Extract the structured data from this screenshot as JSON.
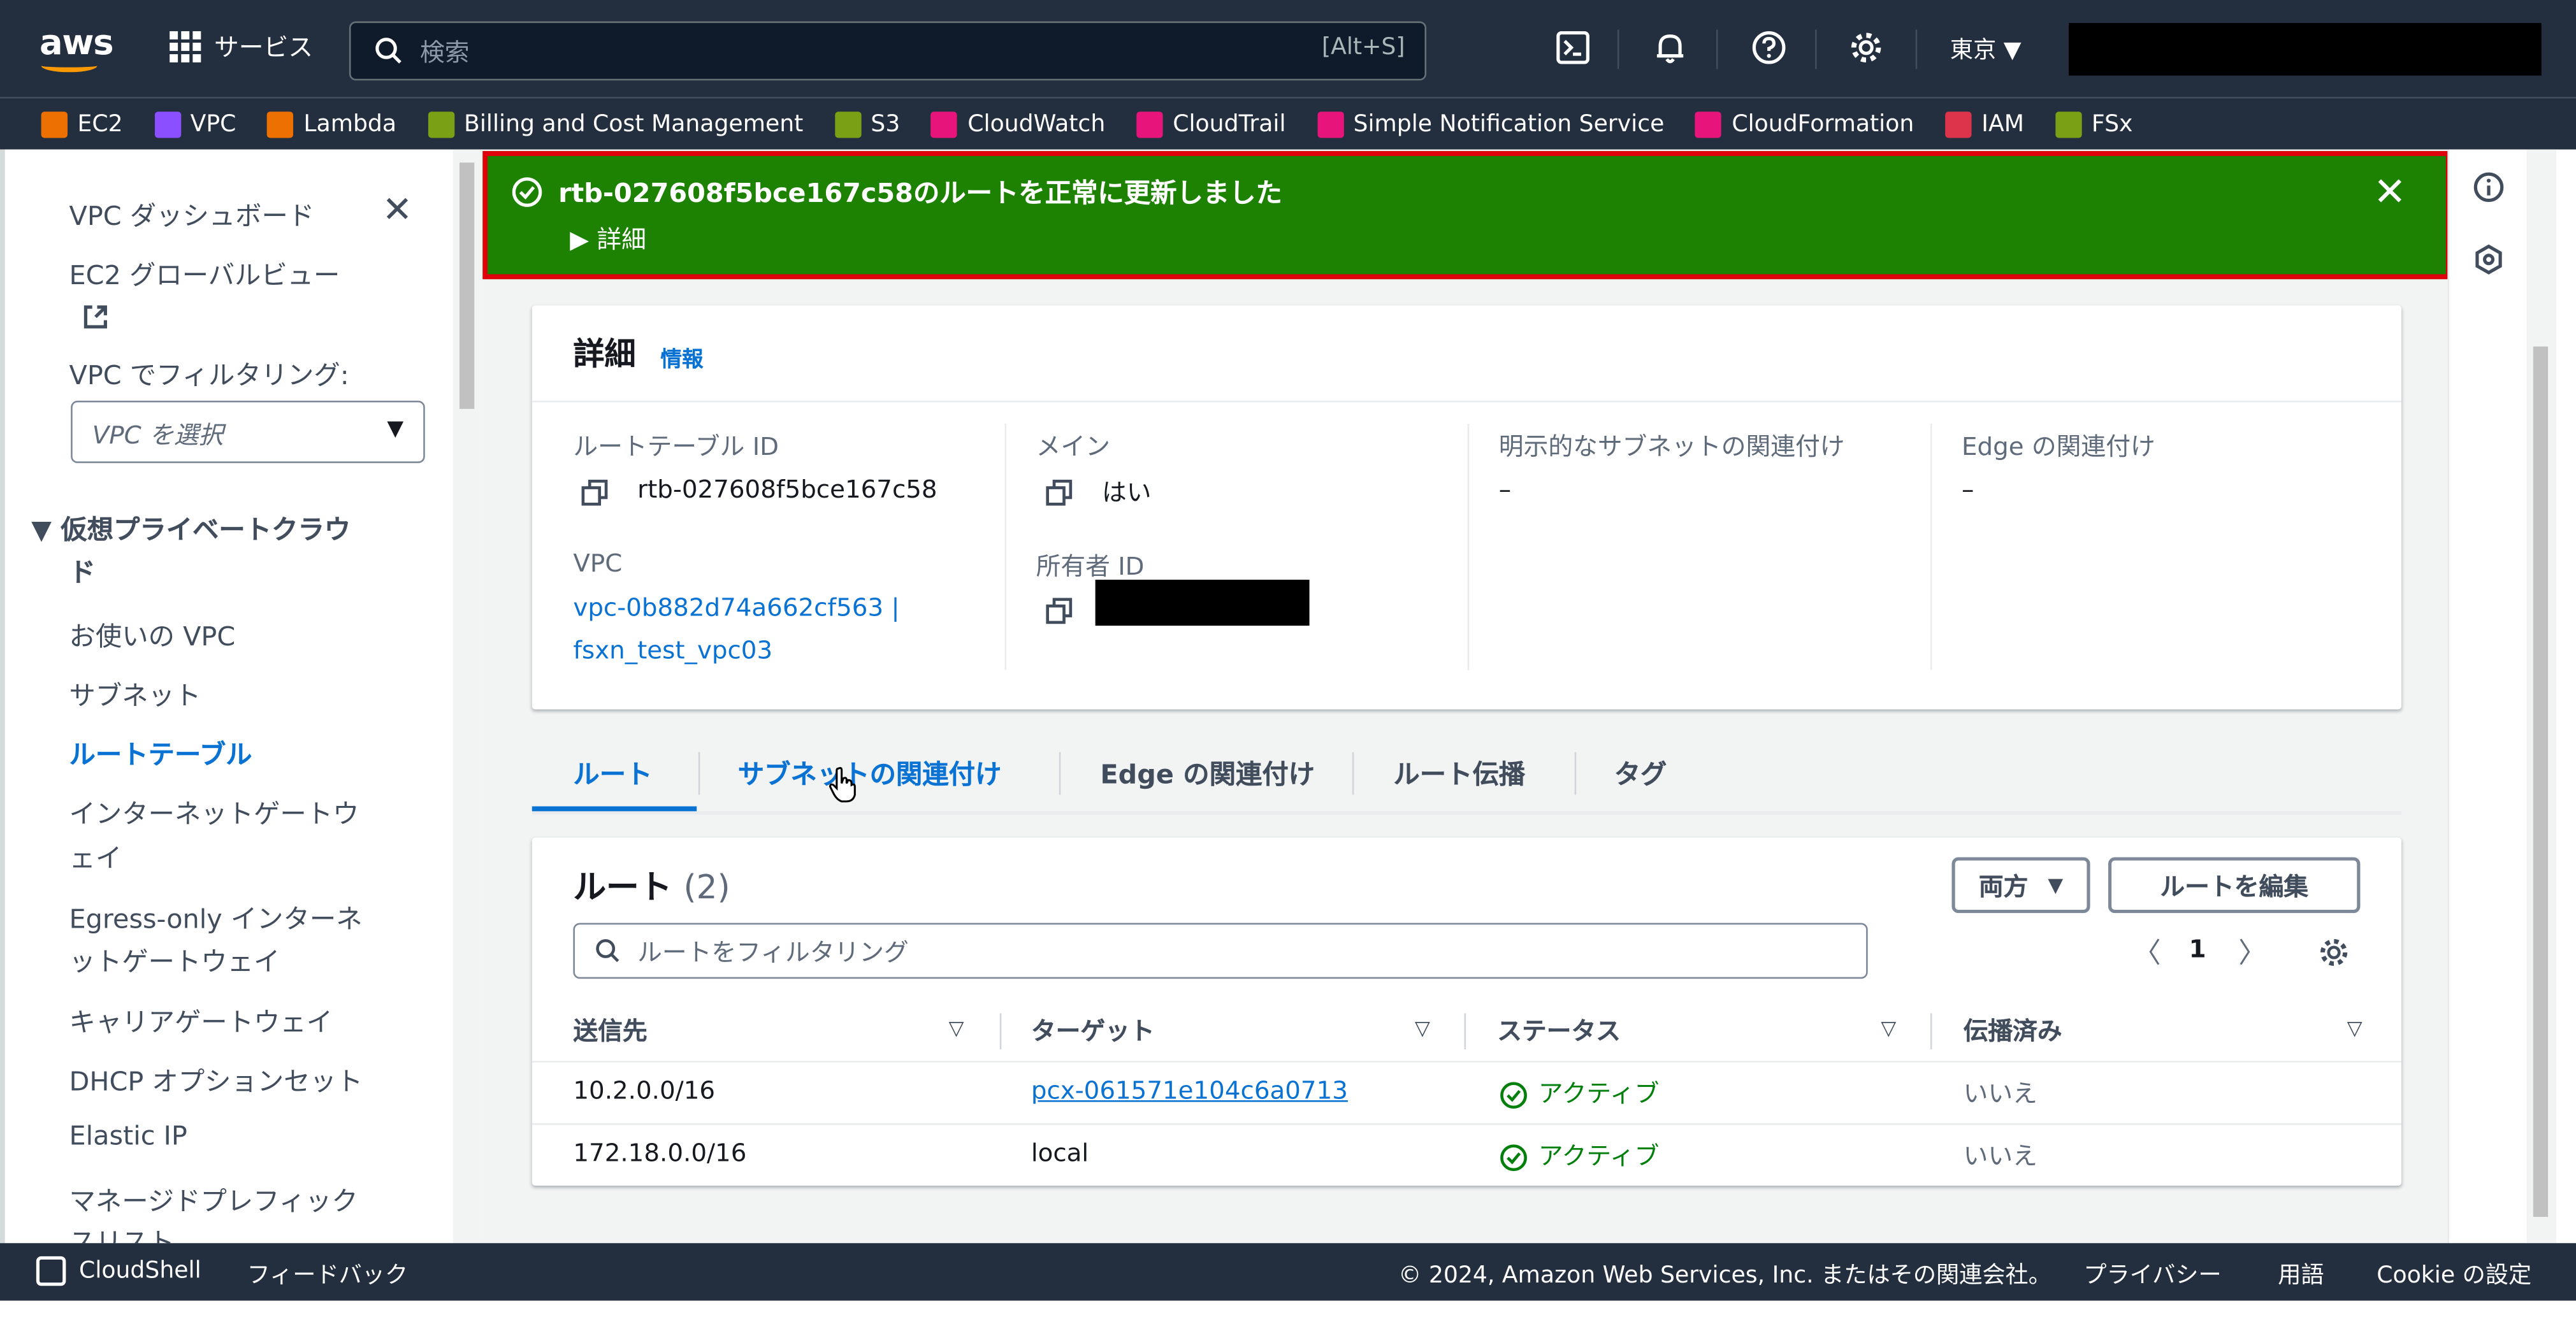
{
  "topnav": {
    "logo": "aws",
    "services_label": "サービス",
    "search_placeholder": "検索",
    "search_shortcut": "[Alt+S]",
    "region": "東京 ▼",
    "icons": [
      "cloudshell-icon",
      "bell-icon",
      "help-icon",
      "gear-icon"
    ]
  },
  "favorites": [
    {
      "label": "EC2",
      "color": "#ed7100"
    },
    {
      "label": "VPC",
      "color": "#8c4fff"
    },
    {
      "label": "Lambda",
      "color": "#ed7100"
    },
    {
      "label": "Billing and Cost Management",
      "color": "#7aa116"
    },
    {
      "label": "S3",
      "color": "#7aa116"
    },
    {
      "label": "CloudWatch",
      "color": "#e7157b"
    },
    {
      "label": "CloudTrail",
      "color": "#e7157b"
    },
    {
      "label": "Simple Notification Service",
      "color": "#e7157b"
    },
    {
      "label": "CloudFormation",
      "color": "#e7157b"
    },
    {
      "label": "IAM",
      "color": "#dd344c"
    },
    {
      "label": "FSx",
      "color": "#7aa116"
    }
  ],
  "sidebar": {
    "dashboard": "VPC ダッシュボード",
    "global_view": "EC2 グローバルビュー",
    "filter_label": "VPC でフィルタリング:",
    "filter_placeholder": "VPC を選択",
    "section_line1": "▼ 仮想プライベートクラウ",
    "section_line2": "ド",
    "items": [
      "お使いの VPC",
      "サブネット",
      "ルートテーブル",
      "インターネットゲートウ",
      "ェイ",
      "Egress-only インターネ",
      "ットゲートウェイ",
      "キャリアゲートウェイ",
      "DHCP オプションセット",
      "Elastic IP",
      "マネージドプレフィック",
      "スリスト"
    ]
  },
  "flash": {
    "message": "rtb-027608f5bce167c58のルートを正常に更新しました",
    "details": "▶ 詳細",
    "color": "#1d8102"
  },
  "details": {
    "title": "詳細",
    "info": "情報",
    "route_table_id_label": "ルートテーブル ID",
    "route_table_id": "rtb-027608f5bce167c58",
    "main_label": "メイン",
    "main_value": "はい",
    "explicit_label": "明示的なサブネットの関連付け",
    "explicit_value": "–",
    "edge_label": "Edge の関連付け",
    "edge_value": "–",
    "vpc_label": "VPC",
    "vpc_line1": "vpc-0b882d74a662cf563 |",
    "vpc_line2": "fsxn_test_vpc03",
    "owner_label": "所有者 ID"
  },
  "tabs": [
    "ルート",
    "サブネットの関連付け",
    "Edge の関連付け",
    "ルート伝播",
    "タグ"
  ],
  "routes": {
    "title": "ルート",
    "count": "(2)",
    "dropdown": "両方",
    "edit_button": "ルートを編集",
    "filter_placeholder": "ルートをフィルタリング",
    "page": "1",
    "columns": [
      "送信先",
      "ターゲット",
      "ステータス",
      "伝播済み"
    ],
    "rows": [
      {
        "destination": "10.2.0.0/16",
        "target": "pcx-061571e104c6a0713",
        "status": "アクティブ",
        "propagated": "いいえ"
      },
      {
        "destination": "172.18.0.0/16",
        "target": "local",
        "status": "アクティブ",
        "propagated": "いいえ"
      }
    ]
  },
  "footer": {
    "cloudshell": "CloudShell",
    "feedback": "フィードバック",
    "copyright": "© 2024, Amazon Web Services, Inc. またはその関連会社。",
    "privacy": "プライバシー",
    "terms": "用語",
    "cookie": "Cookie の設定"
  }
}
